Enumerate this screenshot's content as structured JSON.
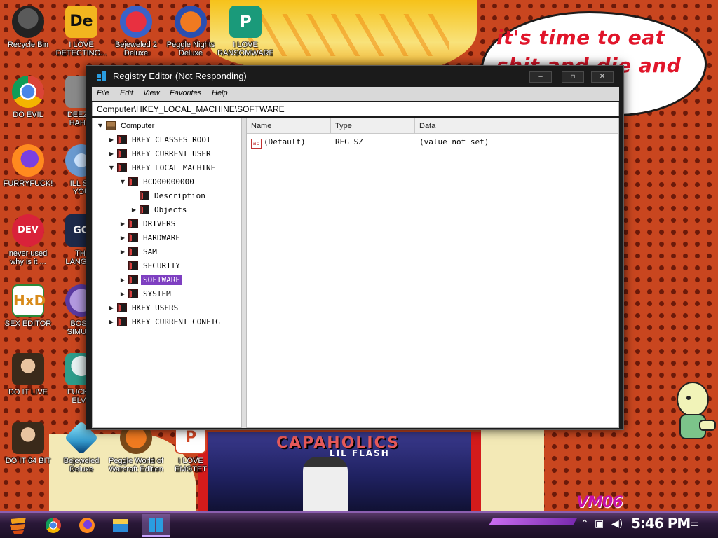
{
  "wallpaper": {
    "bubble_text": "it's time to eat shit and die and chew",
    "poster_title": "CAPAHOLICS",
    "poster_subtitle": "LIL FLASH",
    "tag": "VM06"
  },
  "desktop_icons": [
    {
      "label": "Recycle Bin",
      "icon": "recycle-bin-icon"
    },
    {
      "label": "I LOVE\nDETECTING...",
      "icon": "detect-it-easy-icon"
    },
    {
      "label": "Bejeweled 2\nDeluxe",
      "icon": "bejeweled-2-icon"
    },
    {
      "label": "Peggle Nights\nDeluxe",
      "icon": "peggle-nights-icon"
    },
    {
      "label": "I LOVE\nRANSOMWARE",
      "icon": "ransomware-publisher-icon"
    },
    {
      "label": "DO EVIL",
      "icon": "chrome-icon"
    },
    {
      "label": "DEEZ N\nHAH G",
      "icon": "generic-app-icon"
    },
    {
      "label": "FURRYFUCK!",
      "icon": "firefox-icon"
    },
    {
      "label": "ILL SP\nYOU",
      "icon": "spy-tool-icon"
    },
    {
      "label": "never used\nwhy is it ...",
      "icon": "dev-cpp-icon"
    },
    {
      "label": "THI\nLANGUA",
      "icon": "go-language-icon"
    },
    {
      "label": "SEX EDITOR",
      "icon": "hxd-editor-icon"
    },
    {
      "label": "BOSN\nSIMULA",
      "icon": "bonzi-icon"
    },
    {
      "label": "DO IT LIVE",
      "icon": "portrait-icon"
    },
    {
      "label": "FUCK S\nELVE",
      "icon": "cartoon-icon"
    },
    {
      "label": "DO IT 64 BIT",
      "icon": "portrait-64-icon"
    },
    {
      "label": "Bejeweled\nDeluxe",
      "icon": "bejeweled-icon"
    },
    {
      "label": "Peggle World of\nWarcraft Edition",
      "icon": "peggle-wow-icon"
    },
    {
      "label": "I LOVE EMOTET",
      "icon": "emotet-ppt-icon"
    }
  ],
  "window": {
    "title": "Registry Editor (Not Responding)",
    "minimize": "‒",
    "maximize": "▫",
    "close": "✕",
    "menu": [
      "File",
      "Edit",
      "View",
      "Favorites",
      "Help"
    ],
    "address": "Computer\\HKEY_LOCAL_MACHINE\\SOFTWARE",
    "tree": [
      {
        "label": "Computer",
        "toggle": "▼",
        "kind": "comp"
      },
      {
        "label": "HKEY_CLASSES_ROOT",
        "toggle": "▶"
      },
      {
        "label": "HKEY_CURRENT_USER",
        "toggle": "▶"
      },
      {
        "label": "HKEY_LOCAL_MACHINE",
        "toggle": "▼"
      },
      {
        "label": "BCD00000000",
        "toggle": "▼"
      },
      {
        "label": "Description",
        "toggle": ""
      },
      {
        "label": "Objects",
        "toggle": "▶"
      },
      {
        "label": "DRIVERS",
        "toggle": "▶"
      },
      {
        "label": "HARDWARE",
        "toggle": "▶"
      },
      {
        "label": "SAM",
        "toggle": "▶"
      },
      {
        "label": "SECURITY",
        "toggle": ""
      },
      {
        "label": "SOFTWARE",
        "toggle": "▶",
        "selected": true
      },
      {
        "label": "SYSTEM",
        "toggle": "▶"
      },
      {
        "label": "HKEY_USERS",
        "toggle": "▶"
      },
      {
        "label": "HKEY_CURRENT_CONFIG",
        "toggle": "▶"
      }
    ],
    "columns": [
      "Name",
      "Type",
      "Data"
    ],
    "values": [
      {
        "name": "(Default)",
        "type": "REG_SZ",
        "data": "(value not set)",
        "icon": "ab"
      }
    ]
  },
  "taskbar": {
    "clock": "5:46 PM",
    "items": [
      "start-button-icon",
      "chrome-taskbar-icon",
      "firefox-taskbar-icon",
      "file-explorer-taskbar-icon",
      "regedit-taskbar-icon"
    ]
  },
  "colors": {
    "selection": "#7e3fc1",
    "title_bg": "#1b1b1b",
    "bubble_text": "#e1162b"
  }
}
